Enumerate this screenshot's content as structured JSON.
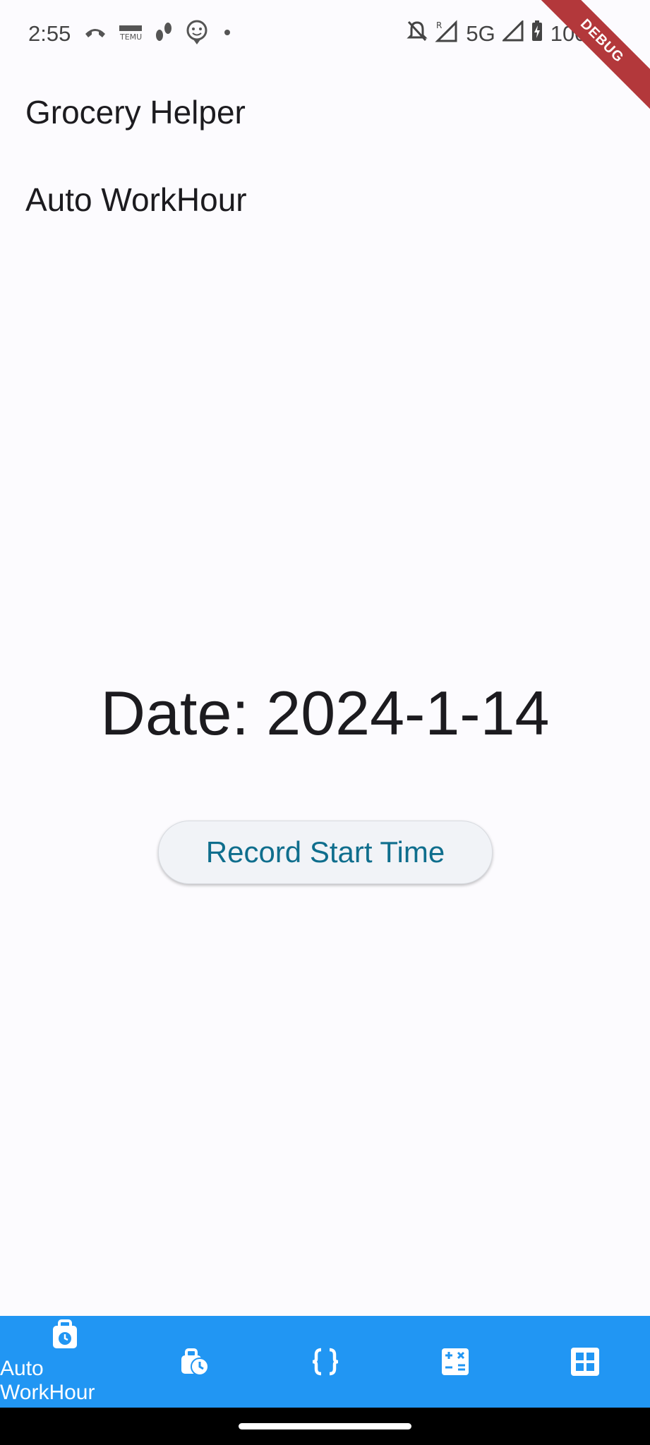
{
  "status_bar": {
    "time": "2:55",
    "network": "5G",
    "battery": "100%",
    "left_icons": [
      "missed-call-icon",
      "temu-icon",
      "footsteps-icon",
      "face-location-icon",
      "dot-icon"
    ],
    "right_icons": [
      "notifications-off-icon",
      "signal-roaming-icon",
      "signal-icon",
      "battery-charging-icon"
    ]
  },
  "debug_banner": "DEBUG",
  "menu": {
    "items": [
      {
        "label": "Grocery Helper"
      },
      {
        "label": "Auto WorkHour"
      }
    ]
  },
  "main": {
    "date_text": "Date: 2024-1-14",
    "record_button": "Record Start Time"
  },
  "bottom_nav": {
    "active_label": "Auto WorkHour",
    "items": [
      "work-bag-clock-icon",
      "bag-clock-icon",
      "braces-icon",
      "calculator-icon",
      "grid-icon"
    ]
  },
  "colors": {
    "nav_bg": "#2196f3",
    "button_text": "#0f6e8d",
    "page_bg": "#fcfbfe",
    "debug": "#b3383b"
  }
}
